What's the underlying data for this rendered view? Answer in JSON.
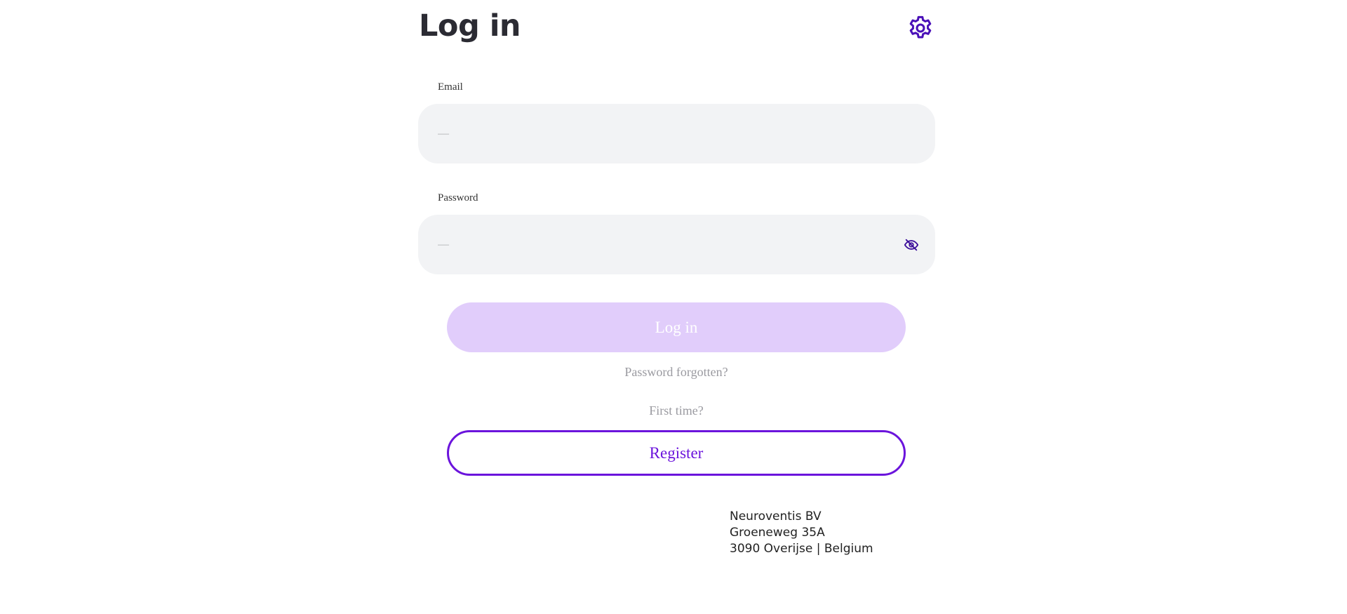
{
  "header": {
    "title": "Log in",
    "settings_icon": "gear-icon"
  },
  "form": {
    "email": {
      "label": "Email",
      "value": "",
      "placeholder": "—"
    },
    "password": {
      "label": "Password",
      "value": "",
      "placeholder": "—",
      "toggle_icon": "eye-off-icon"
    },
    "login_button": "Log in",
    "forgot_password": "Password forgotten?",
    "first_time": "First time?",
    "register_button": "Register"
  },
  "footer": {
    "company": "Neuroventis BV",
    "street": "Groeneweg 35A",
    "city_country": "3090 Overijse | Belgium"
  },
  "colors": {
    "accent": "#6b14dc",
    "login_disabled_bg": "#e1cdfb",
    "input_bg": "#f2f3f5",
    "title": "#2b2b33",
    "muted_text": "#9a9aa0"
  }
}
